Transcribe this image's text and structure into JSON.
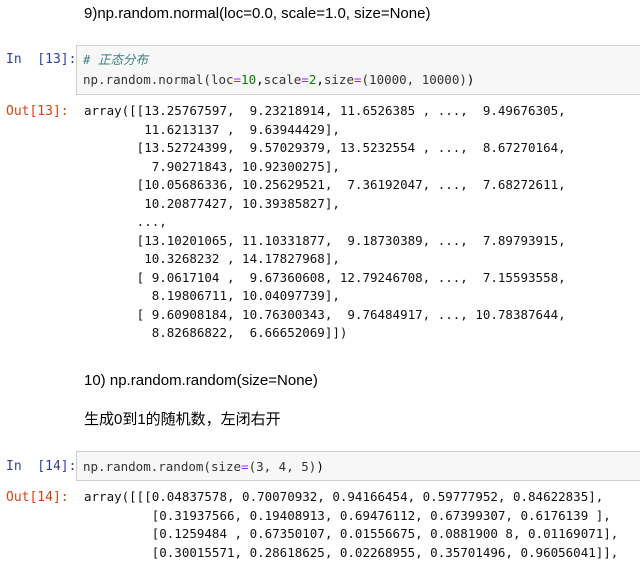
{
  "md_heading_9": "9)np.random.normal(loc=0.0, scale=1.0, size=None)",
  "cell13": {
    "in_prompt": "In  [13]:",
    "comment": "# 正态分布",
    "code": {
      "fn": "np.random.normal(",
      "loc_kw": "loc",
      "loc_val": "10",
      "scale_kw": "scale",
      "scale_val": "2",
      "size_kw": "size",
      "size_val": "(10000, 10000)",
      "close": ")"
    },
    "out_prompt": "Out[13]:",
    "output_lines": [
      "array([[13.25767597,  9.23218914, 11.6526385 , ...,  9.49676305,",
      "        11.6213137 ,  9.63944429],",
      "       [13.52724399,  9.57029379, 13.5232554 , ...,  8.67270164,",
      "         7.90271843, 10.92300275],",
      "       [10.05686336, 10.25629521,  7.36192047, ...,  7.68272611,",
      "        10.20877427, 10.39385827],",
      "       ...,",
      "       [13.10201065, 11.10331877,  9.18730389, ...,  7.89793915,",
      "        10.3268232 , 14.17827968],",
      "       [ 9.0617104 ,  9.67360608, 12.79246708, ...,  7.15593558,",
      "         8.19806711, 10.04097739],",
      "       [ 9.60908184, 10.76300343,  9.76484917, ..., 10.78387644,",
      "         8.82686822,  6.66652069]])"
    ]
  },
  "md_heading_10": "10) np.random.random(size=None)",
  "md_desc_10": "生成0到1的随机数，左闭右开",
  "cell14": {
    "in_prompt": "In  [14]:",
    "code": {
      "fn": "np.random.random(",
      "size_kw": "size",
      "size_val": "(3, 4, 5)",
      "close": ")"
    },
    "out_prompt": "Out[14]:",
    "output_lines": [
      "array([[[0.04837578, 0.70070932, 0.94166454, 0.59777952, 0.84622835],",
      "         [0.31937566, 0.19408913, 0.69476112, 0.67399307, 0.6176139 ],",
      "         [0.1259484 , 0.67350107, 0.01556675, 0.0881900 8, 0.01169071],",
      "         [0.30015571, 0.28618625, 0.02268955, 0.35701496, 0.96056041]],"
    ]
  }
}
